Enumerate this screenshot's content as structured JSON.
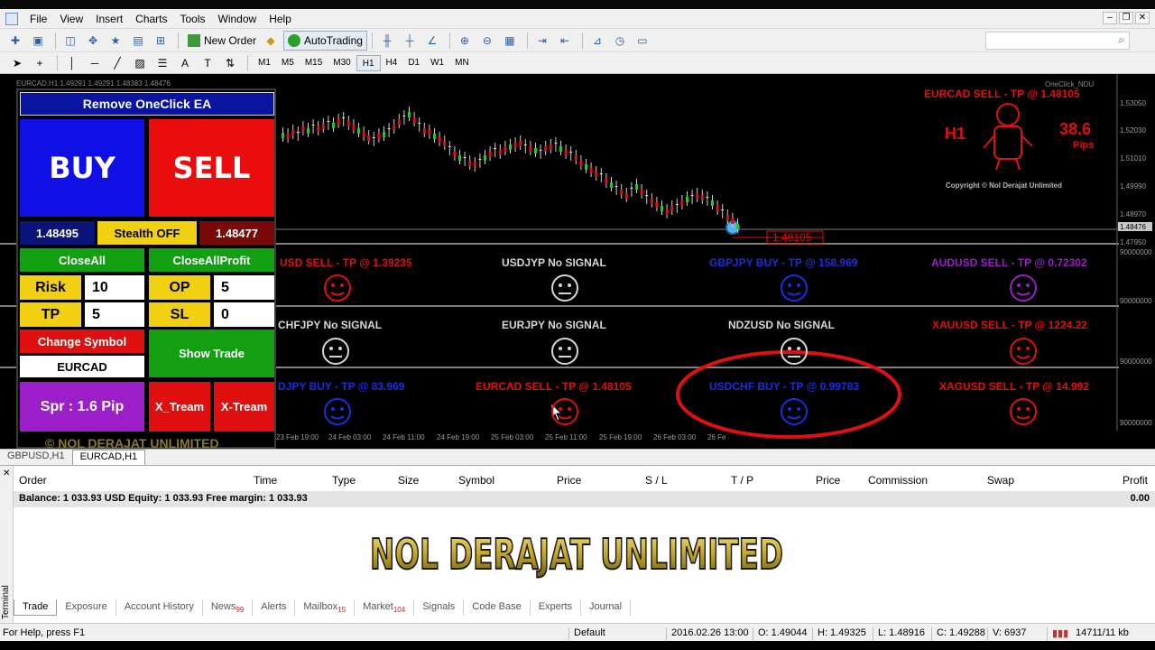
{
  "menu": [
    "File",
    "View",
    "Insert",
    "Charts",
    "Tools",
    "Window",
    "Help"
  ],
  "toolbar": {
    "new_order": "New Order",
    "auto_trading": "AutoTrading"
  },
  "timeframes": [
    "M1",
    "M5",
    "M15",
    "M30",
    "H1",
    "H4",
    "D1",
    "W1",
    "MN"
  ],
  "active_timeframe": "H1",
  "chart": {
    "info": "EURCAD,H1  1.49291 1.49291 1.48383 1.48476",
    "oneclick": "OneClick_NDU",
    "header_signal": "EURCAD SELL - TP @ 1.48105",
    "timeframe_big": "H1",
    "pips_value": "38.6",
    "pips_label": "Pips",
    "copyright": "Copyright © Nol Derajat Unlimited",
    "tp_line_label": "1.48105",
    "price_axis": [
      "1.53050",
      "1.52030",
      "1.51010",
      "1.49990",
      "1.48970",
      "1.48476",
      "1.47950",
      "90000000",
      "90000000",
      "90000000",
      "90000000"
    ],
    "time_axis": [
      "23 Feb 19:00",
      "24 Feb 03:00",
      "24 Feb 11:00",
      "24 Feb 19:00",
      "25 Feb 03:00",
      "25 Feb 11:00",
      "25 Feb 19:00",
      "26 Feb 03:00",
      "26 Fe"
    ]
  },
  "signals": [
    {
      "text": "USD SELL - TP @ 1.39235",
      "color": "red"
    },
    {
      "text": "USDJYP No SIGNAL",
      "color": "white"
    },
    {
      "text": "GBPJPY BUY - TP @ 158.969",
      "color": "blue"
    },
    {
      "text": "AUDUSD SELL - TP @ 0.72302",
      "color": "purple"
    },
    {
      "text": "CHFJPY No SIGNAL",
      "color": "white"
    },
    {
      "text": "EURJPY No SIGNAL",
      "color": "white"
    },
    {
      "text": "NDZUSD No SIGNAL",
      "color": "white"
    },
    {
      "text": "XAUUSD SELL - TP @ 1224.22",
      "color": "red"
    },
    {
      "text": "DJPY BUY - TP @ 83.969",
      "color": "blue"
    },
    {
      "text": "EURCAD SELL - TP @ 1.48105",
      "color": "red"
    },
    {
      "text": "USDCHF BUY - TP @ 0.99783",
      "color": "blue"
    },
    {
      "text": "XAGUSD SELL - TP @ 14.992",
      "color": "red"
    }
  ],
  "panel": {
    "title": "Remove OneClick EA",
    "buy": "BUY",
    "sell": "SELL",
    "bid": "1.48495",
    "stealth": "Stealth OFF",
    "ask": "1.48477",
    "close_all": "CloseAll",
    "close_all_profit": "CloseAllProfit",
    "risk_label": "Risk",
    "risk_value": "10",
    "op_label": "OP",
    "op_value": "5",
    "tp_label": "TP",
    "tp_value": "5",
    "sl_label": "SL",
    "sl_value": "0",
    "change_symbol": "Change Symbol",
    "symbol": "EURCAD",
    "show_trade": "Show Trade",
    "spread": "Spr : 1.6 Pip",
    "xtream1": "X_Tream",
    "xtream2": "X-Tream",
    "banner": "© NOL DERAJAT UNLIMITED"
  },
  "chart_tabs": [
    "GBPUSD,H1",
    "EURCAD,H1"
  ],
  "active_chart_tab": "EURCAD,H1",
  "terminal": {
    "columns": [
      "Order",
      "Time",
      "Type",
      "Size",
      "Symbol",
      "Price",
      "S / L",
      "T / P",
      "Price",
      "Commission",
      "Swap",
      "Profit"
    ],
    "balance_line": "Balance: 1 033.93 USD  Equity: 1 033.93  Free margin: 1 033.93",
    "profit_total": "0.00",
    "banner": "NOL DERAJAT UNLIMITED",
    "side_label": "Terminal",
    "tabs": [
      {
        "label": "Trade",
        "badge": ""
      },
      {
        "label": "Exposure",
        "badge": ""
      },
      {
        "label": "Account History",
        "badge": ""
      },
      {
        "label": "News",
        "badge": "99"
      },
      {
        "label": "Alerts",
        "badge": ""
      },
      {
        "label": "Mailbox",
        "badge": "15"
      },
      {
        "label": "Market",
        "badge": "104"
      },
      {
        "label": "Signals",
        "badge": ""
      },
      {
        "label": "Code Base",
        "badge": ""
      },
      {
        "label": "Experts",
        "badge": ""
      },
      {
        "label": "Journal",
        "badge": ""
      }
    ]
  },
  "status": {
    "help": "For Help, press F1",
    "profile": "Default",
    "datetime": "2016.02.26 13:00",
    "open": "O: 1.49044",
    "high": "H: 1.49325",
    "low": "L: 1.48916",
    "close": "C: 1.49288",
    "volume": "V: 6937",
    "traffic": "14711/11 kb"
  },
  "colors": {
    "buy_blue": "#1010e6",
    "sell_red": "#ea0d0d",
    "green_button": "#12a012",
    "yellow": "#f0d010",
    "purple": "#9b1ec8",
    "highlight_ellipse": "#e01010"
  }
}
